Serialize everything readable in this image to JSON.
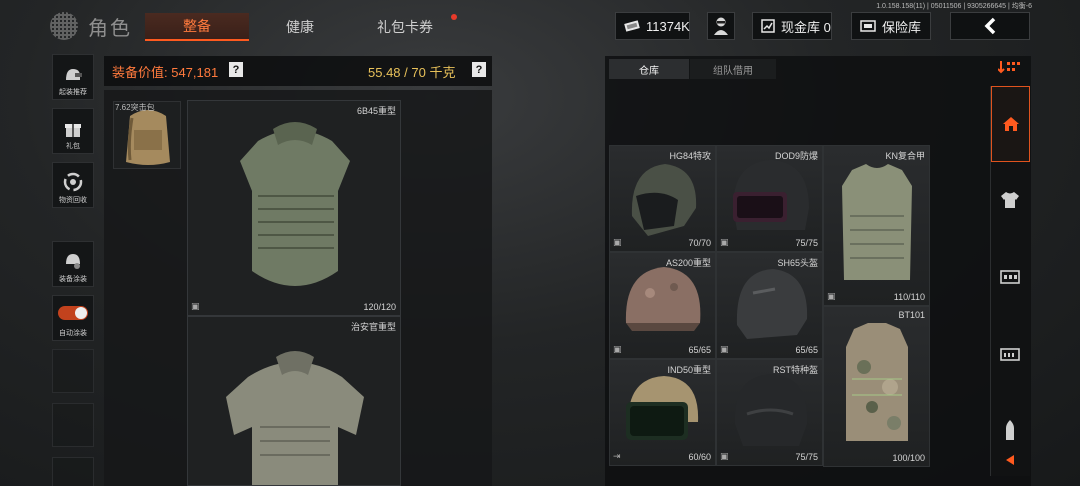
{
  "header": {
    "title": "角色",
    "tabs": [
      {
        "label": "整备",
        "active": true
      },
      {
        "label": "健康",
        "active": false
      },
      {
        "label": "礼包卡券",
        "active": false,
        "badge_dot": true
      }
    ],
    "version": "1.0.158.158(11) | 05011506 | 9305266645 | 均衡-6",
    "currency": {
      "icon": "cash-icon",
      "value": "11374K"
    },
    "avatar_icon": "operator-avatar-icon",
    "cash_vault": {
      "icon": "vault-icon",
      "label": "现金库 0"
    },
    "safe_box": {
      "icon": "safe-icon",
      "label": "保险库"
    },
    "back_icon": "chevron-left-icon"
  },
  "sidebar": {
    "items": [
      {
        "label": "起装推荐",
        "icon": "loadout-icon"
      },
      {
        "label": "礼包",
        "icon": "gift-icon"
      },
      {
        "label": "物资回收",
        "icon": "recycle-icon"
      },
      {
        "label": "装备涂装",
        "icon": "paint-helmet-icon"
      },
      {
        "label": "自动涂装",
        "icon": "toggle-icon",
        "toggle_on": true
      }
    ]
  },
  "loadout": {
    "value_label": "装备价值: 547,181",
    "value_help": "?",
    "weight": "55.48 / 70 千克",
    "weight_help": "?",
    "backpack_name": "7.62突击包",
    "slots": [
      {
        "name": "6B45重型",
        "durability": "120/120"
      },
      {
        "name": "治安官重型",
        "durability": ""
      }
    ]
  },
  "inventory": {
    "tabs": [
      {
        "label": "仓库",
        "active": true
      },
      {
        "label": "组队借用",
        "active": false
      }
    ],
    "items": [
      {
        "name": "HG84特攻",
        "durability": "70/70"
      },
      {
        "name": "DOD9防爆",
        "durability": "75/75"
      },
      {
        "name": "KN复合甲",
        "durability": "110/110"
      },
      {
        "name": "AS200重型",
        "durability": "65/65"
      },
      {
        "name": "SH65头盔",
        "durability": "65/65"
      },
      {
        "name": "BT101",
        "durability": "100/100"
      },
      {
        "name": "IND50重型",
        "durability": "60/60"
      },
      {
        "name": "RST特种盔",
        "durability": "75/75"
      }
    ]
  },
  "right_rail": {
    "filter_icon": "sort-filter-icon",
    "items": [
      "home-icon",
      "shirt-icon",
      "armor-rig-icon",
      "ammo-box-icon",
      "bullet-icon",
      "triangle-left-icon"
    ]
  },
  "colors": {
    "accent": "#ff5a1f",
    "gold": "#e8c15a",
    "panel": "#141617"
  }
}
